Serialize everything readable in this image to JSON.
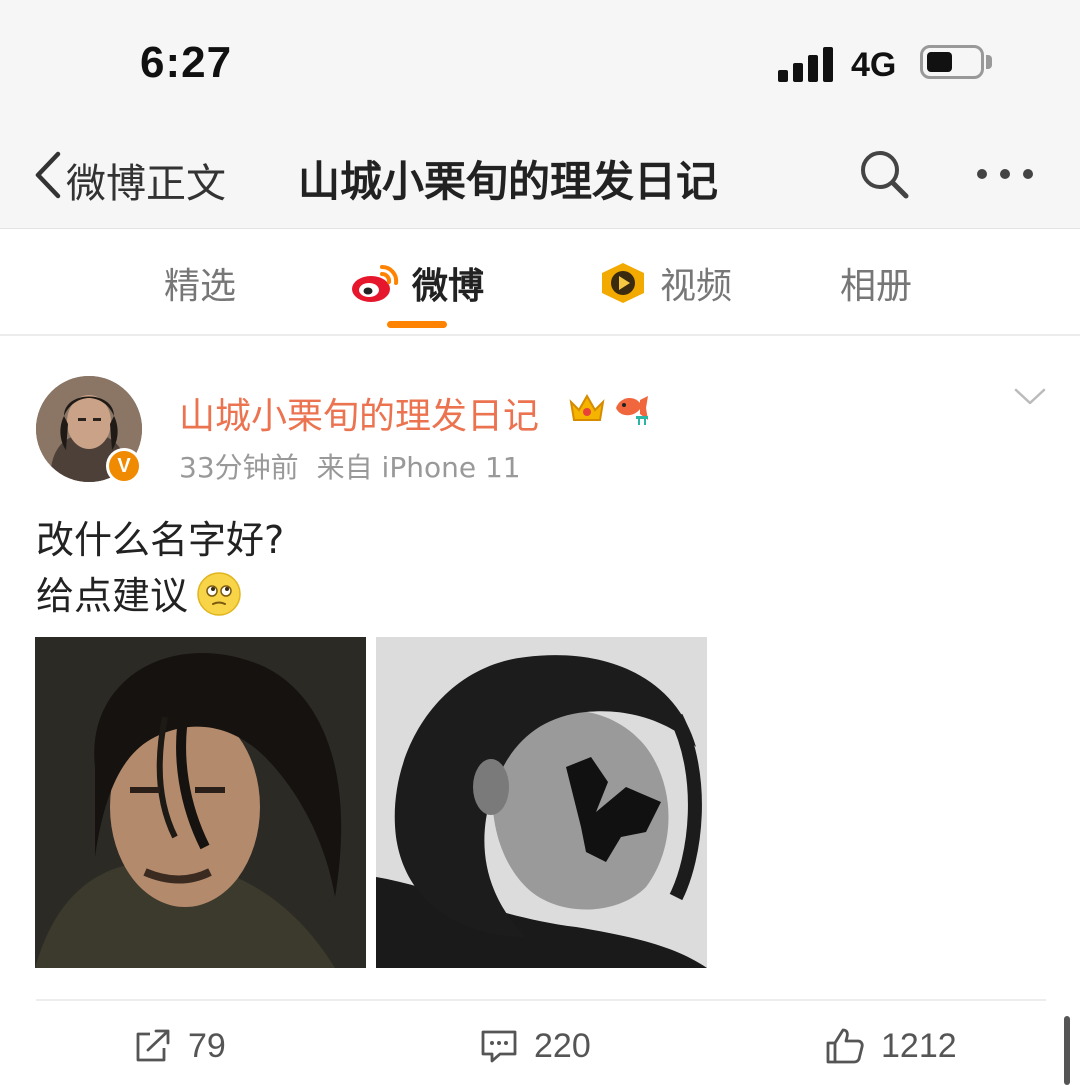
{
  "status": {
    "time": "6:27",
    "network": "4G",
    "battery_level": 0.5
  },
  "nav": {
    "back_label": "微博正文",
    "title": "山城小栗旬的理发日记"
  },
  "tabs": [
    {
      "label": "精选"
    },
    {
      "label": "微博"
    },
    {
      "label": "视频"
    },
    {
      "label": "相册"
    }
  ],
  "active_tab": "微博",
  "post": {
    "username": "山城小栗旬的理发日记",
    "time_ago": "33分钟前",
    "source": "来自 iPhone 11",
    "lines": [
      "改什么名字好?",
      "给点建议"
    ],
    "images_count": 2
  },
  "actions": {
    "reposts": "79",
    "comments": "220",
    "likes": "1212"
  },
  "colors": {
    "accent": "#ff8200",
    "username": "#eb7350",
    "verified": "#f08a00"
  }
}
